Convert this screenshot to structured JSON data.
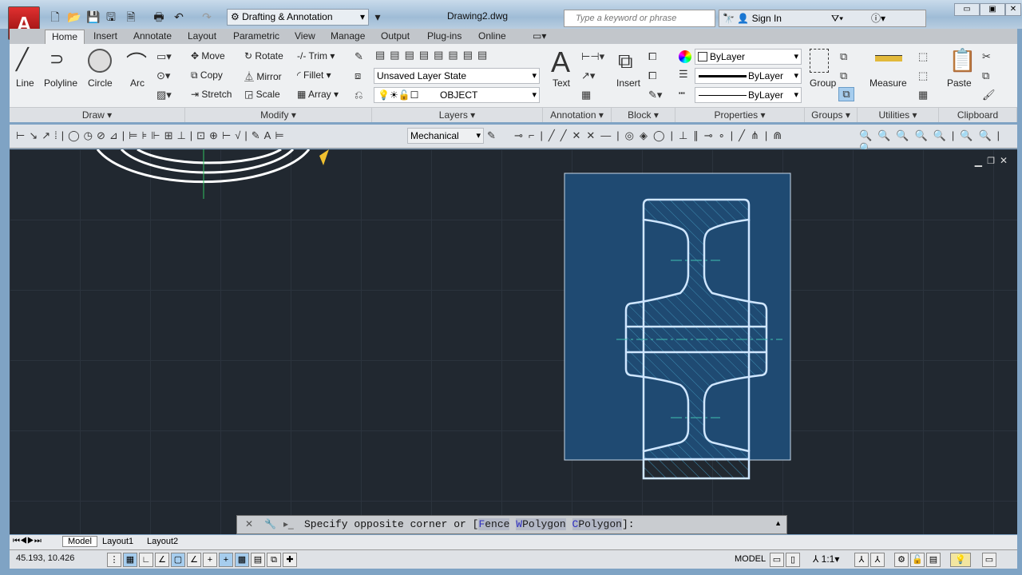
{
  "title_bar": {
    "workspace": "Drafting & Annotation",
    "document_title": "Drawing2.dwg",
    "search_placeholder": "Type a keyword or phrase",
    "sign_in": "Sign In",
    "app_button": "A"
  },
  "tabs": [
    "Home",
    "Insert",
    "Annotate",
    "Layout",
    "Parametric",
    "View",
    "Manage",
    "Output",
    "Plug-ins",
    "Online"
  ],
  "ribbon": {
    "draw": {
      "title": "Draw",
      "items": [
        "Line",
        "Polyline",
        "Circle",
        "Arc"
      ]
    },
    "modify": {
      "title": "Modify",
      "items": [
        "Move",
        "Rotate",
        "Trim",
        "Copy",
        "Mirror",
        "Fillet",
        "Stretch",
        "Scale",
        "Array"
      ]
    },
    "layers": {
      "title": "Layers",
      "layer_state": "Unsaved Layer State",
      "current_layer": "OBJECT"
    },
    "annotation": {
      "title": "Annotation",
      "text": "Text"
    },
    "block": {
      "title": "Block",
      "insert": "Insert"
    },
    "properties": {
      "title": "Properties",
      "color": "ByLayer",
      "lineweight": "ByLayer",
      "linetype": "ByLayer"
    },
    "groups": {
      "title": "Groups",
      "group": "Group"
    },
    "utilities": {
      "title": "Utilities",
      "measure": "Measure"
    },
    "clipboard": {
      "title": "Clipboard",
      "paste": "Paste"
    }
  },
  "toolbar": {
    "dimstyle": "Mechanical"
  },
  "command_line": {
    "prefix": "Specify opposite corner or [",
    "opt1_key": "F",
    "opt1_rest": "ence",
    "opt2_key": "W",
    "opt2_rest": "Polygon",
    "opt3_key": "C",
    "opt3_rest": "Polygon",
    "suffix": "]:"
  },
  "layout_tabs": [
    "Model",
    "Layout1",
    "Layout2"
  ],
  "status": {
    "coords": "45.193, 10.426",
    "space": "MODEL",
    "scale": "1:1"
  }
}
